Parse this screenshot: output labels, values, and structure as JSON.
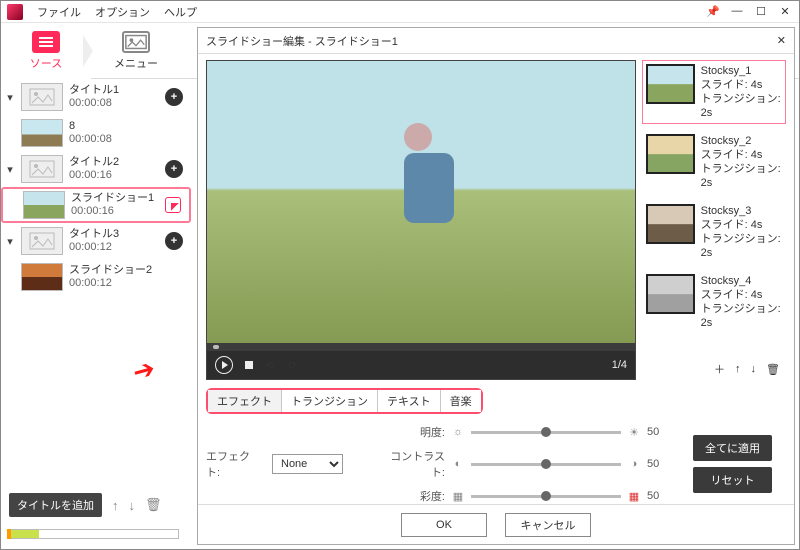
{
  "menu": {
    "file": "ファイル",
    "options": "オプション",
    "help": "ヘルプ"
  },
  "win": {
    "pin": "📌",
    "min": "—",
    "max": "☐",
    "close": "✕"
  },
  "nav": {
    "source": "ソース",
    "menu": "メニュー"
  },
  "tree": [
    {
      "kind": "title",
      "name": "タイトル1",
      "dur": "00:00:08",
      "exp": true,
      "add": true,
      "ph": true
    },
    {
      "kind": "clip",
      "name": "8",
      "dur": "00:00:08"
    },
    {
      "kind": "title",
      "name": "タイトル2",
      "dur": "00:00:16",
      "exp": true,
      "add": true,
      "ph": true
    },
    {
      "kind": "clip",
      "name": "スライドショー1",
      "dur": "00:00:16",
      "sel": true,
      "edit": true
    },
    {
      "kind": "title",
      "name": "タイトル3",
      "dur": "00:00:12",
      "exp": true,
      "add": true,
      "ph": true
    },
    {
      "kind": "clip",
      "name": "スライドショー2",
      "dur": "00:00:12"
    }
  ],
  "addTitleBtn": "タイトルを追加",
  "dialog": {
    "title": "スライドショー編集  -  スライドショー1",
    "close": "✕",
    "index": "1/4",
    "slides": [
      {
        "name": "Stocksy_1",
        "slide": "スライド: 4s",
        "trans": "トランジション: 2s",
        "sel": true
      },
      {
        "name": "Stocksy_2",
        "slide": "スライド: 4s",
        "trans": "トランジション: 2s"
      },
      {
        "name": "Stocksy_3",
        "slide": "スライド: 4s",
        "trans": "トランジション: 2s"
      },
      {
        "name": "Stocksy_4",
        "slide": "スライド: 4s",
        "trans": "トランジション: 2s"
      }
    ],
    "slisttool": {
      "add": "＋",
      "up": "↑",
      "down": "↓",
      "del": "🗑"
    },
    "tabs": {
      "effect": "エフェクト",
      "transition": "トランジション",
      "text": "テキスト",
      "music": "音楽"
    },
    "fxLabel": "エフェクト:",
    "fxValue": "None",
    "sliders": [
      {
        "label": "明度:",
        "iconL": "☼",
        "iconR": "☀",
        "val": "50"
      },
      {
        "label": "コントラスト:",
        "iconL": "◐",
        "iconR": "◑",
        "val": "50"
      },
      {
        "label": "彩度:",
        "iconL": "▦",
        "iconR": "▦",
        "val": "50"
      }
    ],
    "applyAll": "全てに適用",
    "reset": "リセット",
    "ok": "OK",
    "cancel": "キャンセル"
  }
}
